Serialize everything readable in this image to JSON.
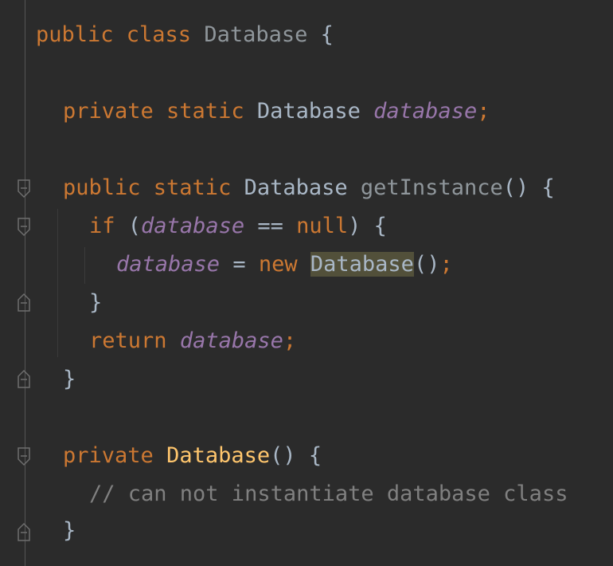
{
  "code": {
    "line1": {
      "kw": "public class",
      "name": "Database",
      "brace": "{"
    },
    "line2": {
      "kw": "private static",
      "type": "Database",
      "field": "database",
      "semi": ";"
    },
    "line3": {
      "kw": "public static",
      "type": "Database",
      "method": "getInstance",
      "rest": "() {"
    },
    "line4": {
      "kw": "if",
      "open": "(",
      "field": "database",
      "op": "==",
      "null": "null",
      "rest": ") {"
    },
    "line5": {
      "field": "database",
      "assign": "=",
      "kw": "new",
      "ctor": "Database",
      "rest": "()",
      "semi": ";"
    },
    "line6": {
      "brace": "}"
    },
    "line7": {
      "kw": "return",
      "field": "database",
      "semi": ";"
    },
    "line8": {
      "brace": "}"
    },
    "line9": {
      "kw": "private",
      "ctor": "Database",
      "rest": "() {"
    },
    "line10": {
      "comment": "// can not instantiate database class"
    },
    "line11": {
      "brace": "}"
    }
  },
  "icons": {
    "fold_open": "fold-open-icon",
    "fold_close": "fold-close-icon"
  },
  "colors": {
    "background": "#2b2b2b",
    "keyword": "#cc7832",
    "field": "#9876aa",
    "constructor": "#ffc66d",
    "comment": "#808080",
    "text": "#a9b7c6",
    "highlight": "#52503a"
  }
}
